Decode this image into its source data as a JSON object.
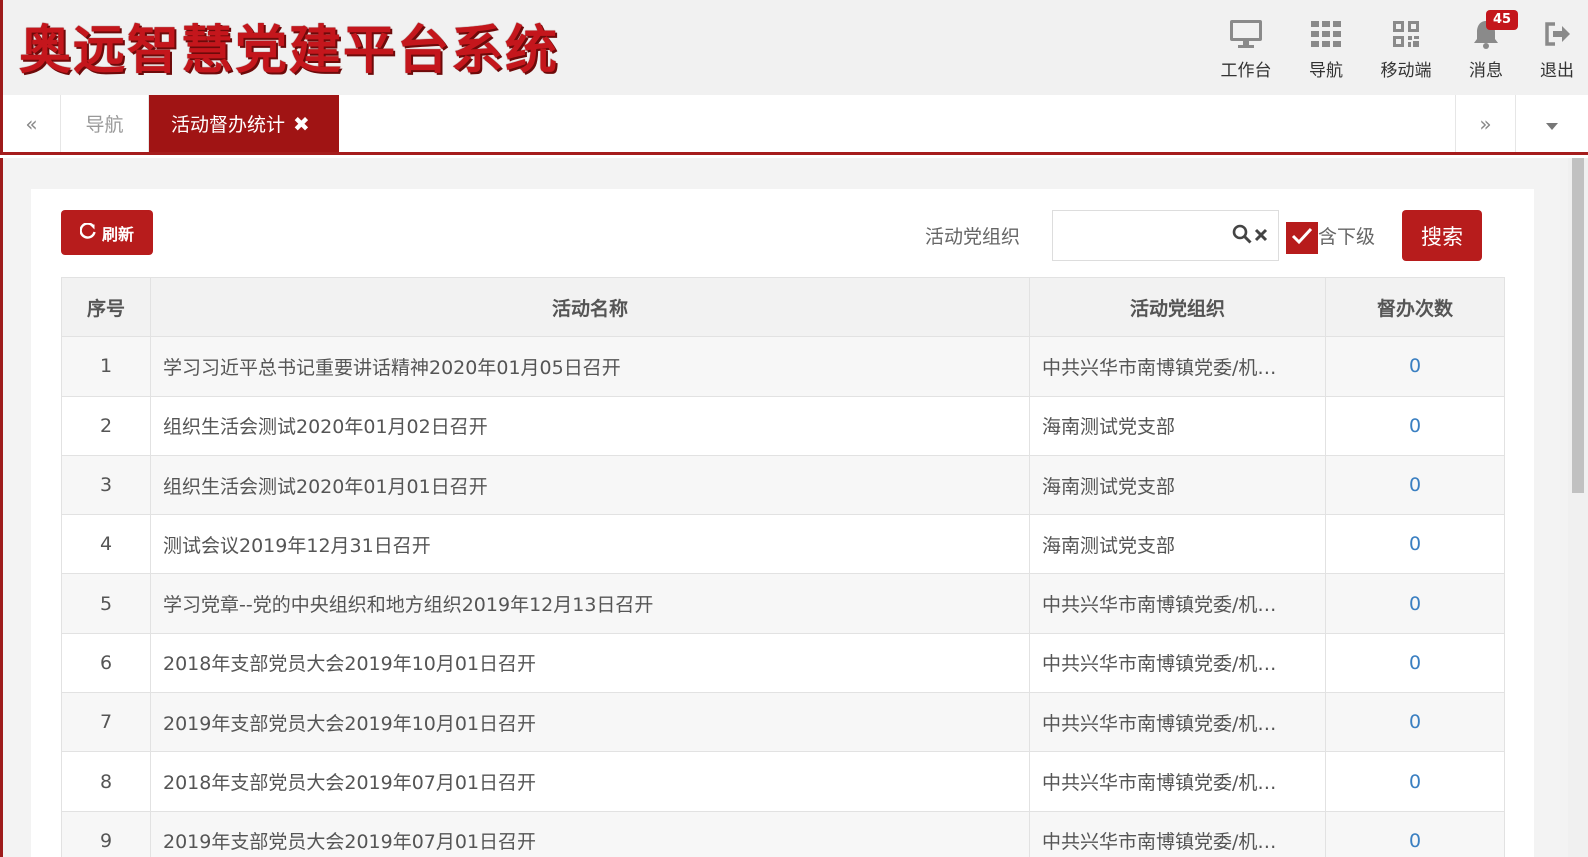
{
  "app": {
    "title": "奥远智慧党建平台系统"
  },
  "header": {
    "nav": [
      {
        "label": "工作台",
        "icon": "monitor-icon"
      },
      {
        "label": "导航",
        "icon": "grid-icon"
      },
      {
        "label": "移动端",
        "icon": "qrcode-icon"
      },
      {
        "label": "消息",
        "icon": "bell-icon",
        "badge": "45"
      },
      {
        "label": "退出",
        "icon": "logout-icon"
      }
    ]
  },
  "tabs": {
    "prev": "«",
    "next": "»",
    "items": [
      {
        "label": "导航",
        "active": false
      },
      {
        "label": "活动督办统计",
        "active": true,
        "close": "✖"
      }
    ]
  },
  "toolbar": {
    "refresh_label": "刷新",
    "filter_label": "活动党组织",
    "search_value": "",
    "include_sub_label": "含下级",
    "include_sub_checked": true,
    "search_label": "搜索"
  },
  "table": {
    "columns": [
      "序号",
      "活动名称",
      "活动党组织",
      "督办次数"
    ],
    "rows": [
      [
        "1",
        "学习习近平总书记重要讲话精神2020年01月05日召开",
        "中共兴华市南博镇党委/机…",
        "0"
      ],
      [
        "2",
        "组织生活会测试2020年01月02日召开",
        "海南测试党支部",
        "0"
      ],
      [
        "3",
        "组织生活会测试2020年01月01日召开",
        "海南测试党支部",
        "0"
      ],
      [
        "4",
        "测试会议2019年12月31日召开",
        "海南测试党支部",
        "0"
      ],
      [
        "5",
        "学习党章--党的中央组织和地方组织2019年12月13日召开",
        "中共兴华市南博镇党委/机…",
        "0"
      ],
      [
        "6",
        "2018年支部党员大会2019年10月01日召开",
        "中共兴华市南博镇党委/机…",
        "0"
      ],
      [
        "7",
        "2019年支部党员大会2019年10月01日召开",
        "中共兴华市南博镇党委/机…",
        "0"
      ],
      [
        "8",
        "2018年支部党员大会2019年07月01日召开",
        "中共兴华市南博镇党委/机…",
        "0"
      ],
      [
        "9",
        "2019年支部党员大会2019年07月01日召开",
        "中共兴华市南博镇党委/机…",
        "0"
      ]
    ]
  },
  "colors": {
    "brand": "#b71c1c",
    "link": "#3a7fc1"
  }
}
